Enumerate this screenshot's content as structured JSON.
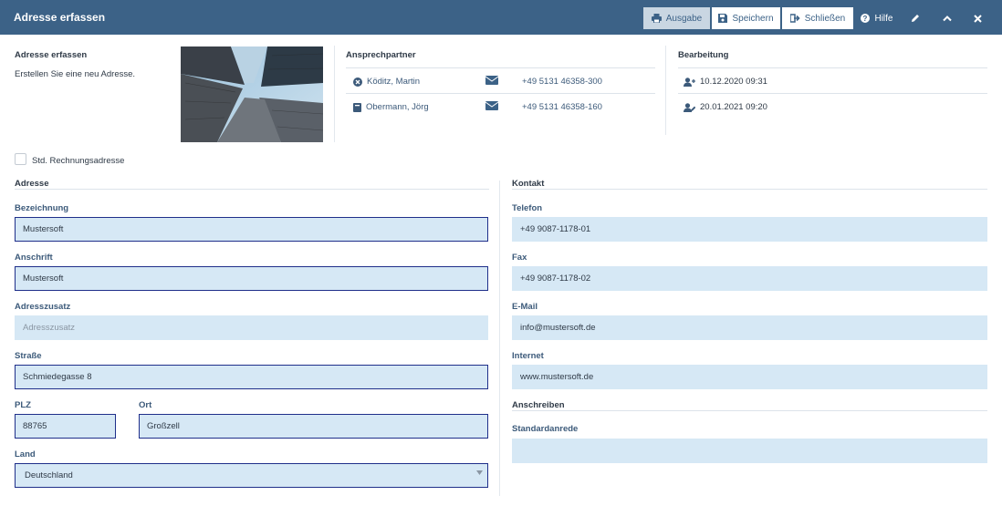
{
  "window": {
    "title": "Adresse erfassen"
  },
  "toolbar": {
    "ausgabe_label": "Ausgabe",
    "speichern_label": "Speichern",
    "schliessen_label": "Schließen",
    "hilfe_label": "Hilfe"
  },
  "header": {
    "info_title": "Adresse erfassen",
    "info_desc": "Erstellen Sie eine neu Adresse.",
    "contacts_title": "Ansprechpartner",
    "contacts": [
      {
        "name": "Köditz, Martin",
        "phone": "+49 5131 46358-300",
        "icon": "close-circle-icon"
      },
      {
        "name": "Obermann, Jörg",
        "phone": "+49 5131 46358-160",
        "icon": "book-icon"
      }
    ],
    "edit_title": "Bearbeitung",
    "created": "10.12.2020 09:31",
    "modified": "20.01.2021 09:20"
  },
  "checkbox": {
    "label": "Std. Rechnungsadresse",
    "checked": false
  },
  "address": {
    "section_title": "Adresse",
    "bezeichnung_label": "Bezeichnung",
    "bezeichnung_value": "Mustersoft",
    "anschrift_label": "Anschrift",
    "anschrift_value": "Mustersoft",
    "zusatz_label": "Adresszusatz",
    "zusatz_placeholder": "Adresszusatz",
    "strasse_label": "Straße",
    "strasse_value": "Schmiedegasse 8",
    "plz_label": "PLZ",
    "plz_value": "88765",
    "ort_label": "Ort",
    "ort_value": "Großzell",
    "land_label": "Land",
    "land_value": "Deutschland"
  },
  "contact": {
    "section_title": "Kontakt",
    "telefon_label": "Telefon",
    "telefon_value": "+49 9087-1178-01",
    "fax_label": "Fax",
    "fax_value": "+49 9087-1178-02",
    "email_label": "E-Mail",
    "email_value": "info@mustersoft.de",
    "internet_label": "Internet",
    "internet_value": "www.mustersoft.de",
    "anschreiben_title": "Anschreiben",
    "anrede_label": "Standardanrede",
    "anrede_value": ""
  },
  "colors": {
    "titlebar": "#3c6287",
    "input_bg": "#d6e8f5",
    "focus_border": "#1f2f8a"
  }
}
